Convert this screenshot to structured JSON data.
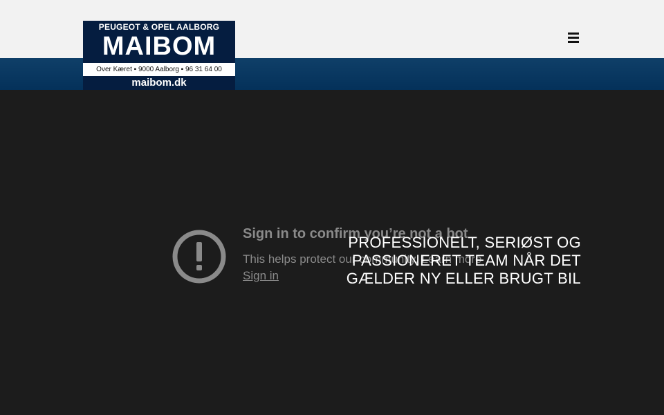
{
  "header": {
    "logo": {
      "line1": "PEUGEOT & OPEL AALBORG",
      "line2": "MAIBOM",
      "line3": "Over Kæret ▪ 9000 Aalborg ▪ 96 31 64 00",
      "line4": "maibom.dk"
    },
    "menu_icon": "hamburger-menu-icon"
  },
  "video": {
    "icon": "exclamation-circle-icon",
    "title": "Sign in to confirm you’re not a bot",
    "text": "This helps protect our community. Learn more",
    "sign_in": "Sign in"
  },
  "hero": {
    "lines": [
      "PROFESSIONELT, SERIØST OG",
      "PASSIONERET TEAM NÅR DET",
      "GÆLDER NY ELLER BRUGT BIL"
    ]
  },
  "colors": {
    "header_bg": "#f2f2f2",
    "blue_band": "#04315a",
    "logo_navy": "#051d40",
    "video_bg": "#1c1c1c"
  }
}
